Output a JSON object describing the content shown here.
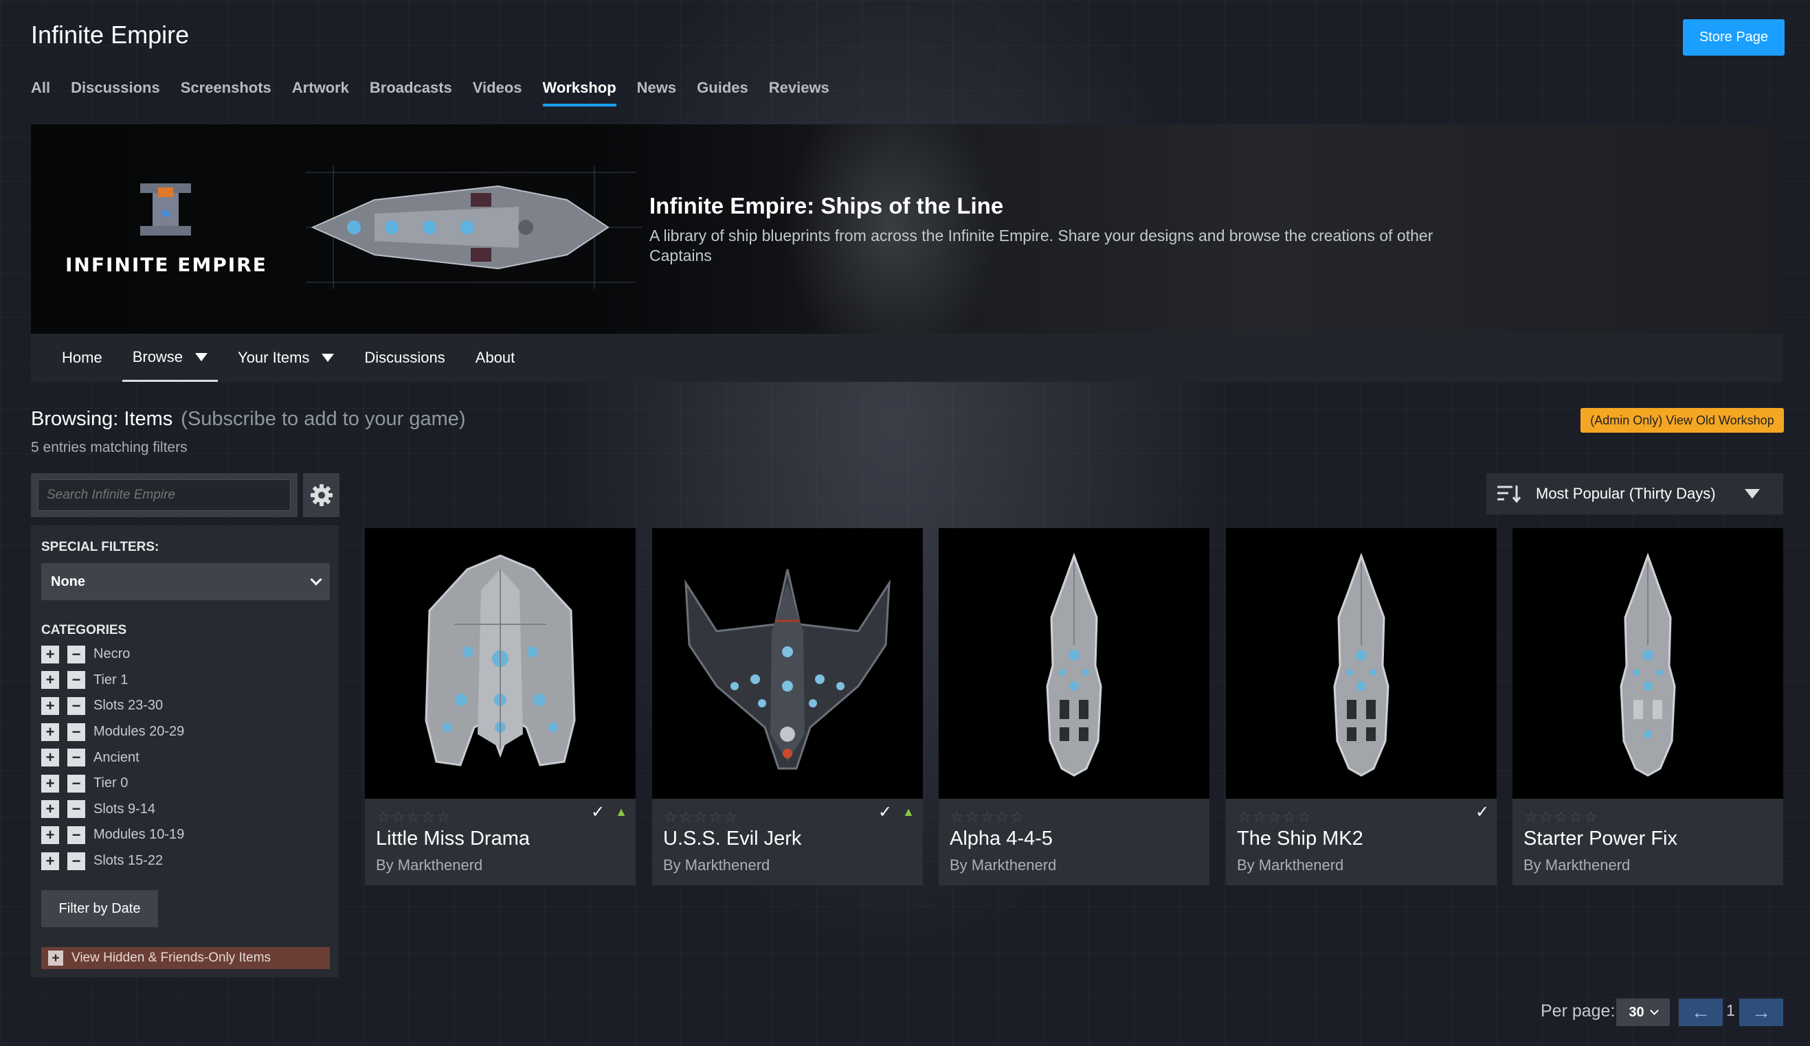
{
  "header": {
    "app_title": "Infinite Empire",
    "store_button": "Store Page"
  },
  "top_nav": {
    "tabs": [
      {
        "label": "All"
      },
      {
        "label": "Discussions"
      },
      {
        "label": "Screenshots"
      },
      {
        "label": "Artwork"
      },
      {
        "label": "Broadcasts"
      },
      {
        "label": "Videos"
      },
      {
        "label": "Workshop",
        "active": true
      },
      {
        "label": "News"
      },
      {
        "label": "Guides"
      },
      {
        "label": "Reviews"
      }
    ]
  },
  "banner": {
    "logo_text": "INFINITE EMPIRE",
    "title": "Infinite Empire: Ships of the Line",
    "description": "A library of ship blueprints from across the Infinite Empire. Share your designs and browse the creations of other Captains"
  },
  "workshop_nav": {
    "items": [
      {
        "label": "Home"
      },
      {
        "label": "Browse",
        "active": true,
        "dropdown": true
      },
      {
        "label": "Your Items",
        "dropdown": true
      },
      {
        "label": "Discussions"
      },
      {
        "label": "About"
      }
    ]
  },
  "browsing": {
    "title": "Browsing: Items",
    "subtitle": "(Subscribe to add to your game)",
    "entries_count": "5 entries matching filters",
    "admin_button": "(Admin Only) View Old Workshop"
  },
  "search": {
    "placeholder": "Search Infinite Empire"
  },
  "sort": {
    "label": "Most Popular (Thirty Days)"
  },
  "filters": {
    "special_filters_label": "SPECIAL FILTERS:",
    "special_filters_value": "None",
    "categories_label": "CATEGORIES",
    "categories": [
      "Necro",
      "Tier 1",
      "Slots 23-30",
      "Modules 20-29",
      "Ancient",
      "Tier 0",
      "Slots 9-14",
      "Modules 10-19",
      "Slots 15-22"
    ],
    "filter_by_date": "Filter by Date",
    "view_hidden": "View Hidden & Friends-Only Items"
  },
  "items": [
    {
      "title": "Little Miss Drama",
      "author": "By Markthenerd",
      "subscribed": true,
      "favorited": true,
      "rating_stars": 0
    },
    {
      "title": "U.S.S. Evil Jerk",
      "author": "By Markthenerd",
      "subscribed": true,
      "favorited": true,
      "rating_stars": 0
    },
    {
      "title": "Alpha 4-4-5",
      "author": "By Markthenerd",
      "subscribed": false,
      "favorited": false,
      "rating_stars": 0
    },
    {
      "title": "The Ship MK2",
      "author": "By Markthenerd",
      "subscribed": true,
      "favorited": false,
      "rating_stars": 0
    },
    {
      "title": "Starter Power Fix",
      "author": "By Markthenerd",
      "subscribed": false,
      "favorited": false,
      "rating_stars": 0
    }
  ],
  "pagination": {
    "per_page_label": "Per page:",
    "per_page_value": "30",
    "current_page": "1"
  },
  "colors": {
    "accent": "#1a9fff",
    "admin_button": "#f5a623",
    "page_button": "#2e4f7a"
  }
}
